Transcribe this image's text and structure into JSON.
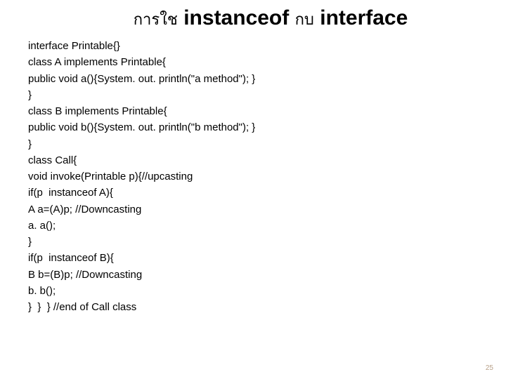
{
  "title": {
    "thai_prefix": "การใช",
    "keyword1": "instanceof",
    "thai_mid": "กบ",
    "keyword2": "interface"
  },
  "code": {
    "lines": [
      "interface Printable{}",
      "class A implements Printable{",
      "public void a(){System. out. println(\"a method\"); }",
      "}",
      "class B implements Printable{",
      "public void b(){System. out. println(\"b method\"); }",
      "}",
      "class Call{",
      "void invoke(Printable p){//upcasting",
      "if(p  instanceof A){",
      "A a=(A)p; //Downcasting",
      "a. a();",
      "}",
      "if(p  instanceof B){",
      "B b=(B)p; //Downcasting",
      "b. b();",
      "}  }  } //end of Call class"
    ]
  },
  "page_number": "25"
}
